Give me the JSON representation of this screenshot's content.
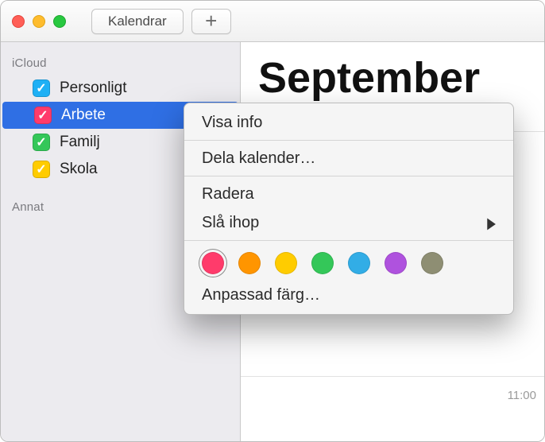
{
  "titlebar": {
    "calendars_button": "Kalendrar"
  },
  "sidebar": {
    "sections": {
      "icloud": "iCloud",
      "other": "Annat"
    },
    "items": [
      {
        "label": "Personligt",
        "color": "#1eb0f5"
      },
      {
        "label": "Arbete",
        "color": "#ff3b6b"
      },
      {
        "label": "Familj",
        "color": "#34c759"
      },
      {
        "label": "Skola",
        "color": "#ffcc00"
      }
    ]
  },
  "main": {
    "month": "September",
    "time_label": "11:00"
  },
  "context_menu": {
    "show_info": "Visa info",
    "share": "Dela kalender…",
    "delete": "Radera",
    "merge": "Slå ihop",
    "custom_color": "Anpassad färg…",
    "colors": [
      "#ff3b6b",
      "#ff9500",
      "#ffcc00",
      "#34c759",
      "#32ade6",
      "#af52de",
      "#8e8e73"
    ]
  }
}
